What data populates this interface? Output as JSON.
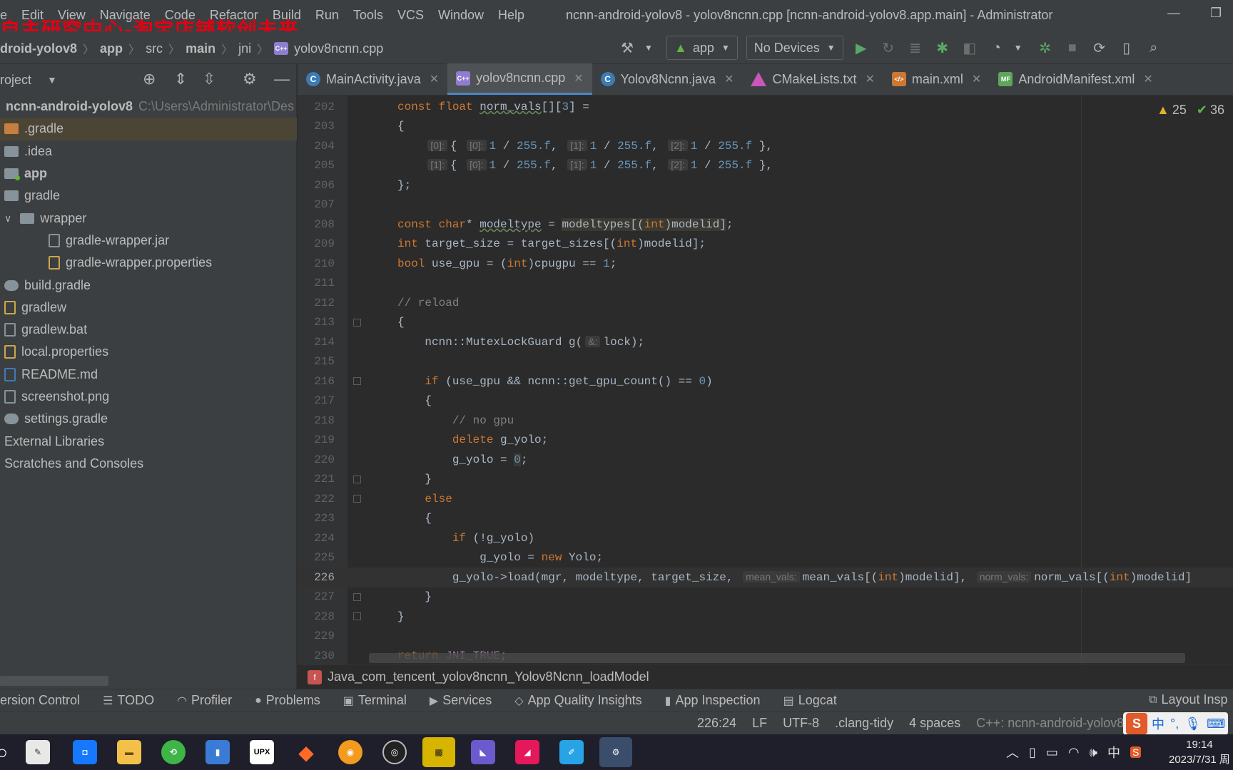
{
  "watermark": "自主研究中心-淘宝店铺软创未来",
  "menu": {
    "items": [
      "e",
      "Edit",
      "View",
      "Navigate",
      "Code",
      "Refactor",
      "Build",
      "Run",
      "Tools",
      "VCS",
      "Window",
      "Help"
    ],
    "window_title": "ncnn-android-yolov8 - yolov8ncnn.cpp [ncnn-android-yolov8.app.main] - Administrator"
  },
  "breadcrumb": [
    "droid-yolov8",
    "app",
    "src",
    "main",
    "jni",
    "yolov8ncnn.cpp"
  ],
  "toolbar": {
    "run_config": "app",
    "device": "No Devices"
  },
  "project": {
    "title": "roject",
    "root_name": "ncnn-android-yolov8",
    "root_path": "C:\\Users\\Administrator\\Des",
    "items": [
      ".gradle",
      ".idea",
      "app",
      "gradle",
      "wrapper",
      "gradle-wrapper.jar",
      "gradle-wrapper.properties",
      "build.gradle",
      "gradlew",
      "gradlew.bat",
      "local.properties",
      "README.md",
      "screenshot.png",
      "settings.gradle",
      "External Libraries",
      "Scratches and Consoles"
    ]
  },
  "tabs": [
    {
      "label": "MainActivity.java",
      "icon": "C"
    },
    {
      "label": "yolov8ncnn.cpp",
      "icon": "C++"
    },
    {
      "label": "Yolov8Ncnn.java",
      "icon": "C"
    },
    {
      "label": "CMakeLists.txt",
      "icon": "cmake"
    },
    {
      "label": "main.xml",
      "icon": "</>"
    },
    {
      "label": "AndroidManifest.xml",
      "icon": "MF"
    }
  ],
  "inspections": {
    "warnings": "25",
    "ok": "36"
  },
  "code": {
    "line_numbers": [
      "202",
      "203",
      "204",
      "205",
      "206",
      "207",
      "208",
      "209",
      "210",
      "211",
      "212",
      "213",
      "214",
      "215",
      "216",
      "217",
      "218",
      "219",
      "220",
      "221",
      "222",
      "223",
      "224",
      "225",
      "226",
      "227",
      "228",
      "229",
      "230"
    ],
    "hints": {
      "idx0": "[0]:",
      "idx1": "[1]:",
      "idx2": "[2]:",
      "amp": "&:",
      "mean": "mean_vals:",
      "norm": "norm_vals:"
    }
  },
  "function_crumb": "Java_com_tencent_yolov8ncnn_Yolov8Ncnn_loadModel",
  "tool_windows": [
    "ersion Control",
    "TODO",
    "Profiler",
    "Problems",
    "Terminal",
    "Services",
    "App Quality Insights",
    "App Inspection",
    "Logcat"
  ],
  "tool_right": "Layout Insp",
  "status": {
    "position": "226:24",
    "line_sep": "LF",
    "encoding": "UTF-8",
    "linter": ".clang-tidy",
    "indent": "4 spaces",
    "context": "C++: ncnn-android-yolov8."
  },
  "ime": {
    "logo": "S",
    "lang": "中",
    "punct": "°,"
  },
  "taskbar": {
    "upx_label": "UPX"
  },
  "tray": {
    "lang": "中"
  },
  "clock": {
    "time": "19:14",
    "date": "2023/7/31 周"
  }
}
